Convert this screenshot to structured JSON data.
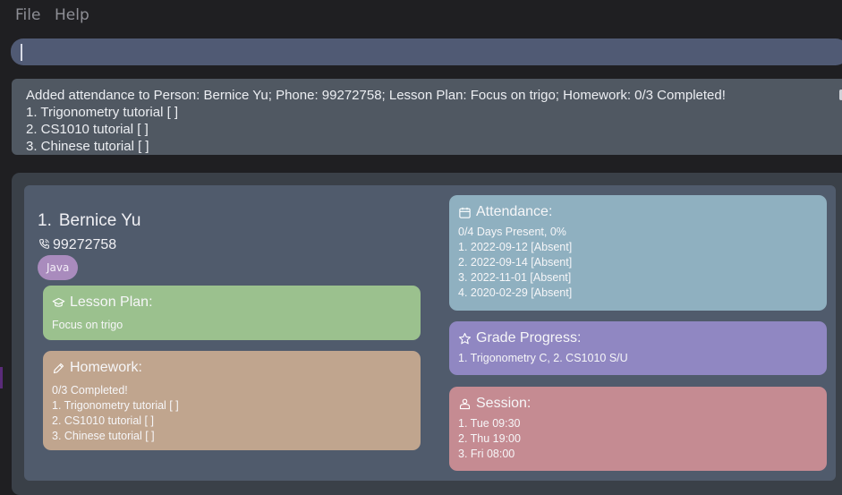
{
  "menu": {
    "file": "File",
    "help": "Help"
  },
  "command_box": {
    "value": ""
  },
  "result_display": {
    "lines": [
      "Added attendance to Person: Bernice Yu; Phone: 99272758; Lesson Plan: Focus on trigo; Homework: 0/3 Completed!",
      "1. Trigonometry tutorial [ ]",
      "2. CS1010 tutorial [ ]",
      "3. Chinese tutorial [ ]"
    ]
  },
  "person": {
    "index": "1.",
    "name": "Bernice Yu",
    "phone": "99272758",
    "tags": [
      "Java"
    ],
    "lesson_plan": {
      "title": "Lesson Plan:",
      "value": "Focus on trigo"
    },
    "homework": {
      "title": "Homework:",
      "lines": [
        "0/3 Completed!",
        "1. Trigonometry tutorial [ ]",
        "2. CS1010 tutorial [ ]",
        "3. Chinese tutorial [ ]"
      ]
    },
    "attendance": {
      "title": "Attendance:",
      "lines": [
        "0/4 Days Present, 0%",
        "1. 2022-09-12 [Absent]",
        "2. 2022-09-14 [Absent]",
        "3. 2022-11-01 [Absent]",
        "4. 2020-02-29 [Absent]"
      ]
    },
    "grade_progress": {
      "title": "Grade Progress:",
      "value": "1. Trigonometry C, 2. CS1010 S/U"
    },
    "session": {
      "title": "Session:",
      "lines": [
        "1. Tue 09:30",
        "2. Thu 19:00",
        "3. Fri 08:00"
      ]
    }
  },
  "colors": {
    "lesson_plan": "#9bc18e",
    "homework": "#c0a58e",
    "attendance": "#8fb0c0",
    "grade_progress": "#9087c2",
    "session": "#c58b92",
    "tag": "#a98bbd"
  },
  "icons": {
    "phone": "phone-icon",
    "lesson_plan": "graduation-cap-icon",
    "homework": "pencil-icon",
    "attendance": "calendar-icon",
    "grade_progress": "star-icon",
    "session": "people-icon"
  }
}
